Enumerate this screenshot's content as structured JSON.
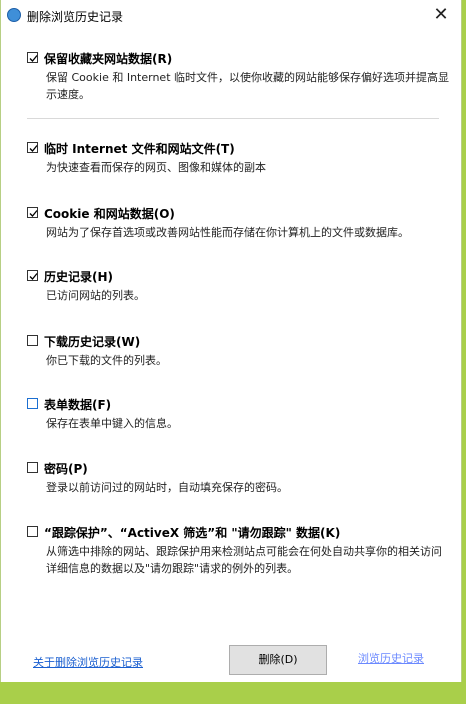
{
  "window": {
    "title": "删除浏览历史记录",
    "close_glyph": "✕"
  },
  "options": [
    {
      "label": "保留收藏夹网站数据(R)",
      "desc": "保留 Cookie 和 Internet 临时文件，以使你收藏的网站能够保存偏好选项并提高显示速度。",
      "checked": true
    },
    {
      "label": "临时 Internet 文件和网站文件(T)",
      "desc": "为快速查看而保存的网页、图像和媒体的副本",
      "checked": true
    },
    {
      "label": "Cookie 和网站数据(O)",
      "desc": "网站为了保存首选项或改善网站性能而存储在你计算机上的文件或数据库。",
      "checked": true
    },
    {
      "label": "历史记录(H)",
      "desc": "已访问网站的列表。",
      "checked": true
    },
    {
      "label": "下载历史记录(W)",
      "desc": "你已下载的文件的列表。",
      "checked": false
    },
    {
      "label": "表单数据(F)",
      "desc": "保存在表单中键入的信息。",
      "checked": false
    },
    {
      "label": "密码(P)",
      "desc": "登录以前访问过的网站时，自动填充保存的密码。",
      "checked": false
    },
    {
      "label": "“跟踪保护”、“ActiveX 筛选”和 \"请勿跟踪\" 数据(K)",
      "desc": "从筛选中排除的网站、跟踪保护用来检测站点可能会在何处自动共享你的相关访问详细信息的数据以及\"请勿跟踪\"请求的例外的列表。",
      "checked": false
    }
  ],
  "footer": {
    "about_link": "关于删除浏览历史记录",
    "delete_button": "删除(D)",
    "cancel_button": "浏览历史记录"
  },
  "colors": {
    "accent": "#1a5fd0",
    "frame": "#a9cf4a"
  }
}
